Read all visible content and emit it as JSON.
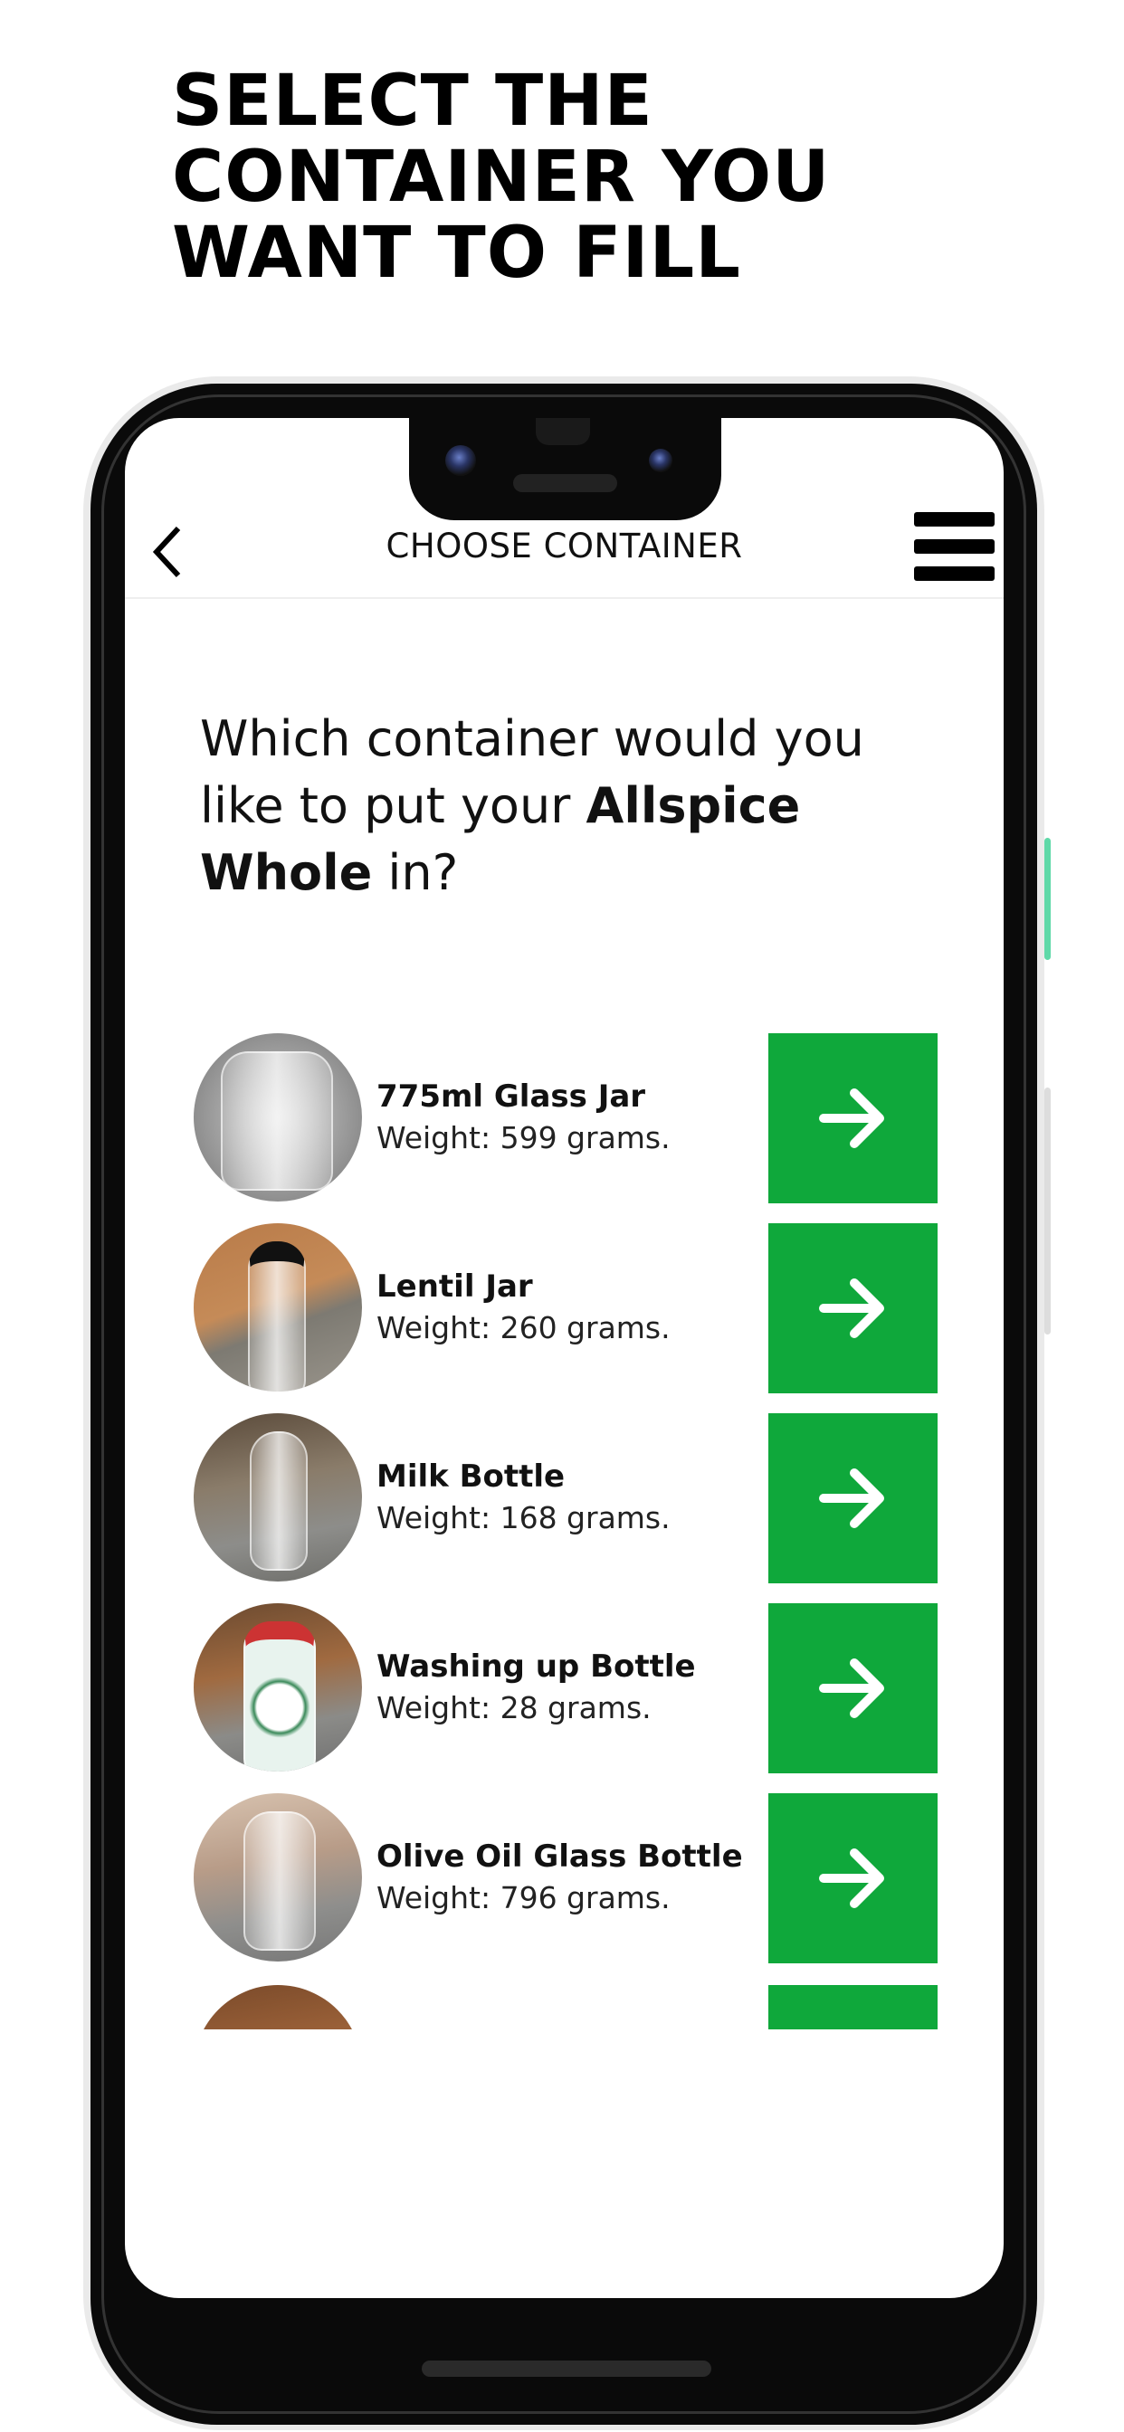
{
  "heading": {
    "lines": [
      "SELECT THE",
      "CONTAINER YOU",
      "WANT TO FILL"
    ]
  },
  "header": {
    "title": "CHOOSE CONTAINER",
    "back_icon": "chevron-left-icon",
    "menu_icon": "hamburger-menu-icon"
  },
  "question": {
    "prefix": "Which container would you like to put your ",
    "product": "Allspice Whole",
    "suffix": " in?"
  },
  "accent_color": "#0fa83b",
  "containers": [
    {
      "name": "775ml Glass Jar",
      "weight": "Weight: 599 grams."
    },
    {
      "name": "Lentil Jar",
      "weight": "Weight: 260 grams."
    },
    {
      "name": "Milk Bottle",
      "weight": "Weight: 168 grams."
    },
    {
      "name": "Washing up Bottle",
      "weight": "Weight: 28 grams."
    },
    {
      "name": "Olive Oil Glass Bottle",
      "weight": "Weight: 796 grams."
    }
  ]
}
